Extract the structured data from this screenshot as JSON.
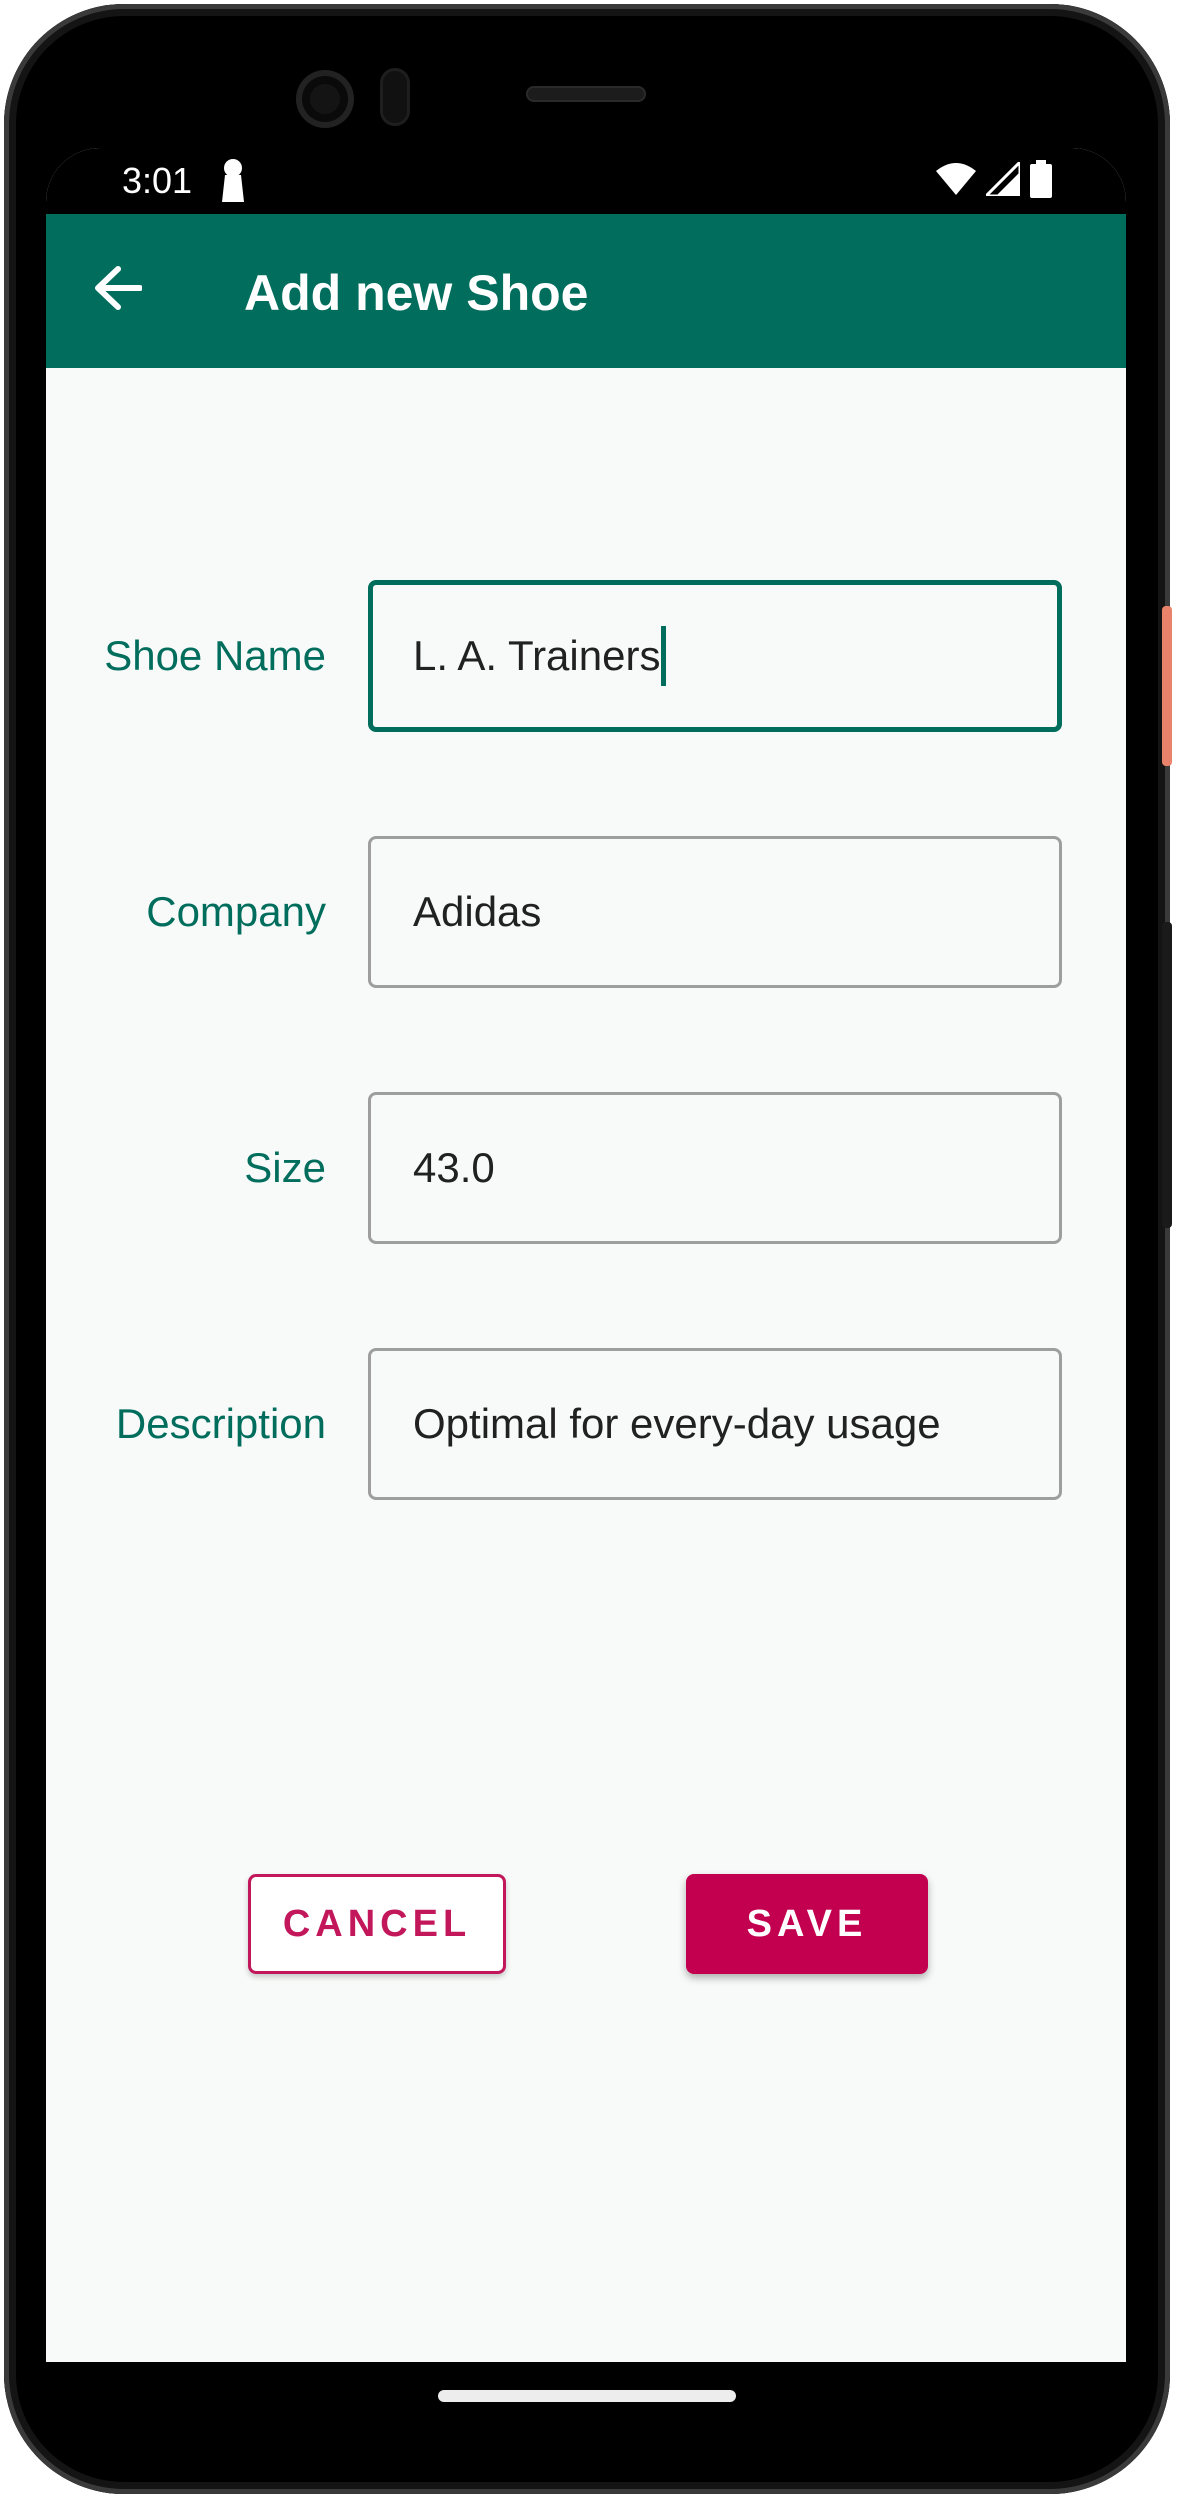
{
  "status_bar": {
    "time": "3:01",
    "icons": [
      "person-icon",
      "wifi-icon",
      "signal-icon",
      "battery-icon"
    ]
  },
  "app_bar": {
    "title": "Add new Shoe",
    "back_icon": "arrow-back-icon"
  },
  "form": {
    "fields": [
      {
        "label": "Shoe Name",
        "value": "L. A. Trainers",
        "focused": true
      },
      {
        "label": "Company",
        "value": "Adidas",
        "focused": false
      },
      {
        "label": "Size",
        "value": "43.0",
        "focused": false
      },
      {
        "label": "Description",
        "value": "Optimal for every-day usage",
        "focused": false
      }
    ]
  },
  "actions": {
    "cancel_label": "CANCEL",
    "save_label": "SAVE"
  },
  "colors": {
    "primary": "#006d5d",
    "accent": "#c2004f",
    "background": "#f8faf9"
  }
}
